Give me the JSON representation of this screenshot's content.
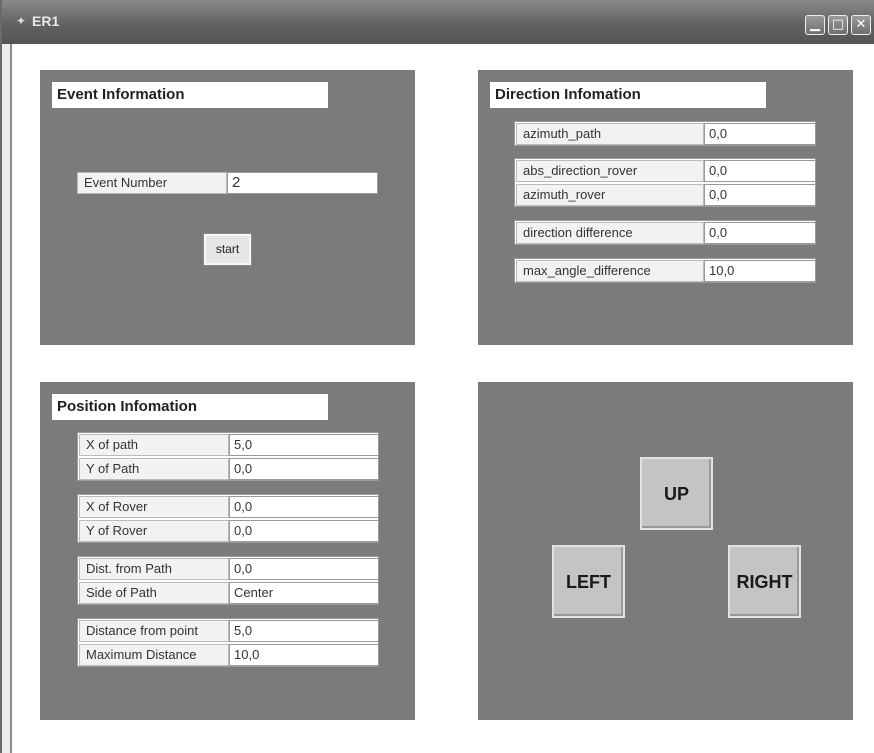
{
  "window": {
    "title": "ER1",
    "app_icon": "app-window-icon",
    "controls": {
      "minimize_icon": "minimize-icon",
      "maximize_icon": "maximize-icon",
      "close_icon": "close-icon"
    }
  },
  "event_panel": {
    "title": "Event Information",
    "event_number_label": "Event Number",
    "event_number_value": "2",
    "start_button_label": "start"
  },
  "direction_panel": {
    "title": "Direction Infomation",
    "fields": [
      {
        "label": "azimuth_path",
        "value": "0,0"
      },
      {
        "label": "abs_direction_rover",
        "value": "0,0"
      },
      {
        "label": "azimuth_rover",
        "value": "0,0"
      },
      {
        "label": "direction difference",
        "value": "0,0"
      },
      {
        "label": "max_angle_difference",
        "value": "10,0"
      }
    ]
  },
  "position_panel": {
    "title": "Position Infomation",
    "fields": [
      {
        "label": "X of path",
        "value": "5,0"
      },
      {
        "label": "Y of Path",
        "value": "0,0"
      },
      {
        "label": "X of Rover",
        "value": "0,0"
      },
      {
        "label": "Y of Rover",
        "value": "0,0"
      },
      {
        "label": "Dist. from Path",
        "value": "0,0"
      },
      {
        "label": "Side of Path",
        "value": "Center"
      },
      {
        "label": "Distance from point",
        "value": "5,0"
      },
      {
        "label": "Maximum Distance",
        "value": "10,0"
      }
    ]
  },
  "control_panel": {
    "up_label": "UP",
    "left_label": "LEFT",
    "right_label": "RIGHT"
  },
  "colors": {
    "panel_bg": "#7b7b7b",
    "titlebar_bg": "#666666",
    "button_bg": "#c4c4c4"
  }
}
